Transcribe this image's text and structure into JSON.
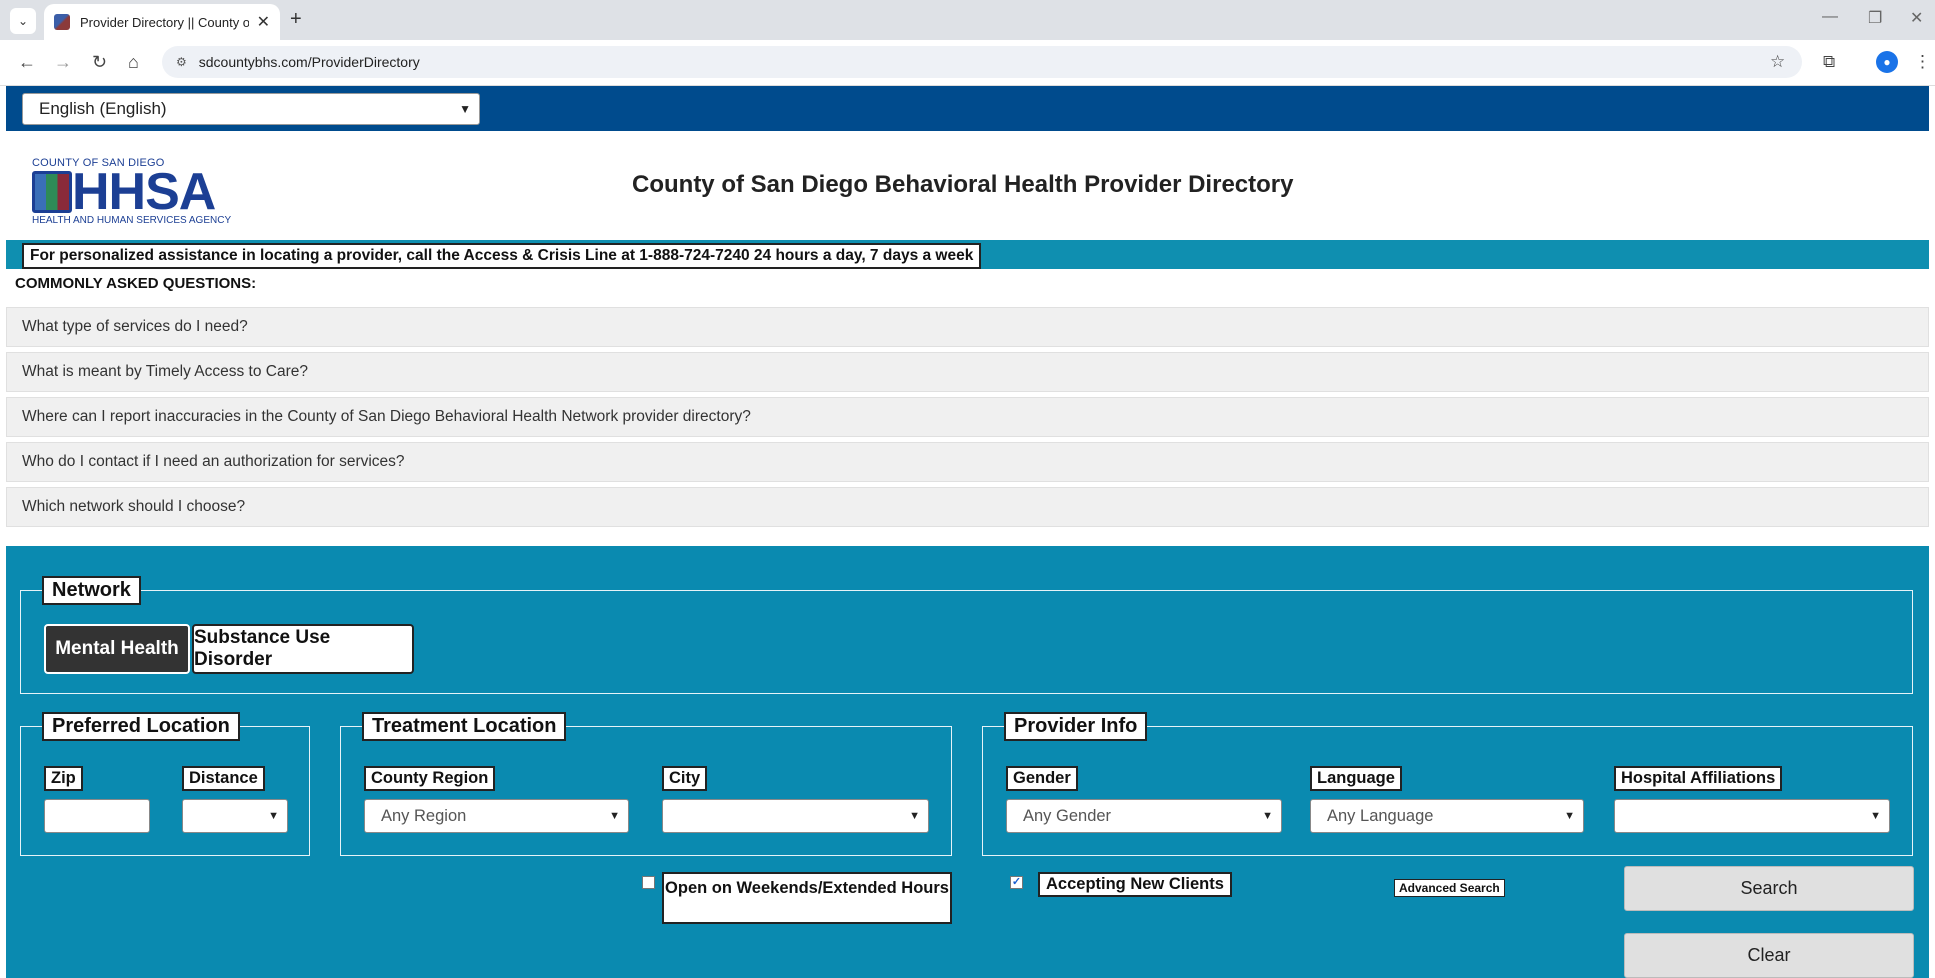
{
  "browser": {
    "tab_title": "Provider Directory || County of S",
    "tab_close": "✕",
    "new_tab": "+",
    "url": "sdcountybhs.com/ProviderDirectory"
  },
  "language": {
    "selected": "English (English)"
  },
  "header": {
    "logo_top": "COUNTY OF SAN DIEGO",
    "logo_mark": "HHSA",
    "logo_bottom": "HEALTH AND HUMAN SERVICES AGENCY",
    "title": "County of San Diego Behavioral Health Provider Directory"
  },
  "crisis": {
    "text": "For personalized assistance in locating a provider, call the Access & Crisis Line at 1-888-724-7240 24 hours a day, 7 days a week"
  },
  "faq": {
    "heading": "COMMONLY ASKED QUESTIONS:",
    "items": [
      "What type of services do I need?",
      "What is meant by Timely Access to Care?",
      "Where can I report inaccuracies in the County of San Diego Behavioral Health Network provider directory?",
      "Who do I contact if I need an authorization for services?",
      "Which network should I choose?"
    ]
  },
  "search": {
    "network": {
      "legend": "Network",
      "options": [
        "Mental Health",
        "Substance Use Disorder"
      ],
      "selected": "Mental Health"
    },
    "preferred_location": {
      "legend": "Preferred Location",
      "zip_label": "Zip",
      "zip_value": "",
      "distance_label": "Distance",
      "distance_value": ""
    },
    "treatment_location": {
      "legend": "Treatment Location",
      "region_label": "County Region",
      "region_value": "Any Region",
      "city_label": "City",
      "city_value": ""
    },
    "provider_info": {
      "legend": "Provider Info",
      "gender_label": "Gender",
      "gender_value": "Any Gender",
      "language_label": "Language",
      "language_value": "Any Language",
      "hospital_label": "Hospital Affiliations",
      "hospital_value": ""
    },
    "weekends_label": "Open on Weekends/Extended Hours",
    "weekends_checked": false,
    "accepting_label": "Accepting New Clients",
    "accepting_checked": true,
    "advanced_label": "Advanced Search",
    "search_button": "Search",
    "clear_button": "Clear"
  }
}
